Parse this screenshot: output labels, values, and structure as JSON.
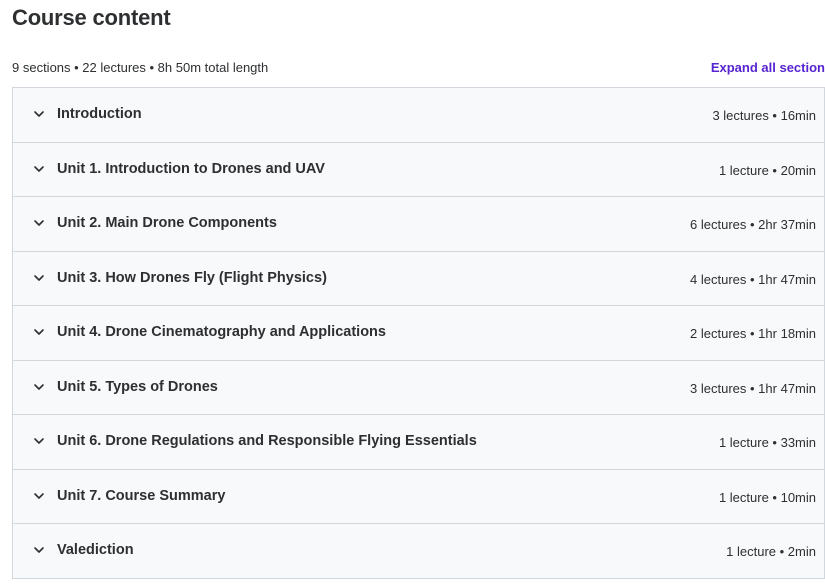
{
  "header": {
    "title": "Course content",
    "summary": "9 sections • 22 lectures • 8h 50m total length",
    "expand_all_label": "Expand all section"
  },
  "sections": [
    {
      "title": "Introduction",
      "meta": "3 lectures • 16min"
    },
    {
      "title": "Unit 1. Introduction to Drones and UAV",
      "meta": "1 lecture • 20min"
    },
    {
      "title": "Unit 2. Main Drone Components",
      "meta": "6 lectures • 2hr 37min"
    },
    {
      "title": "Unit 3. How Drones Fly (Flight Physics)",
      "meta": "4 lectures • 1hr 47min"
    },
    {
      "title": "Unit 4. Drone Cinematography and Applications",
      "meta": "2 lectures • 1hr 18min"
    },
    {
      "title": "Unit 5. Types of Drones",
      "meta": "3 lectures • 1hr 47min"
    },
    {
      "title": "Unit 6. Drone Regulations and Responsible Flying Essentials",
      "meta": "1 lecture • 33min"
    },
    {
      "title": "Unit 7. Course Summary",
      "meta": "1 lecture • 10min"
    },
    {
      "title": "Valediction",
      "meta": "1 lecture • 2min"
    }
  ],
  "icons": {
    "section_toggle": "chevron-down-icon"
  },
  "colors": {
    "text": "#2d2f31",
    "accent": "#5624d0",
    "panel_bg": "#f7f9fa",
    "border": "#d1d7dc"
  }
}
